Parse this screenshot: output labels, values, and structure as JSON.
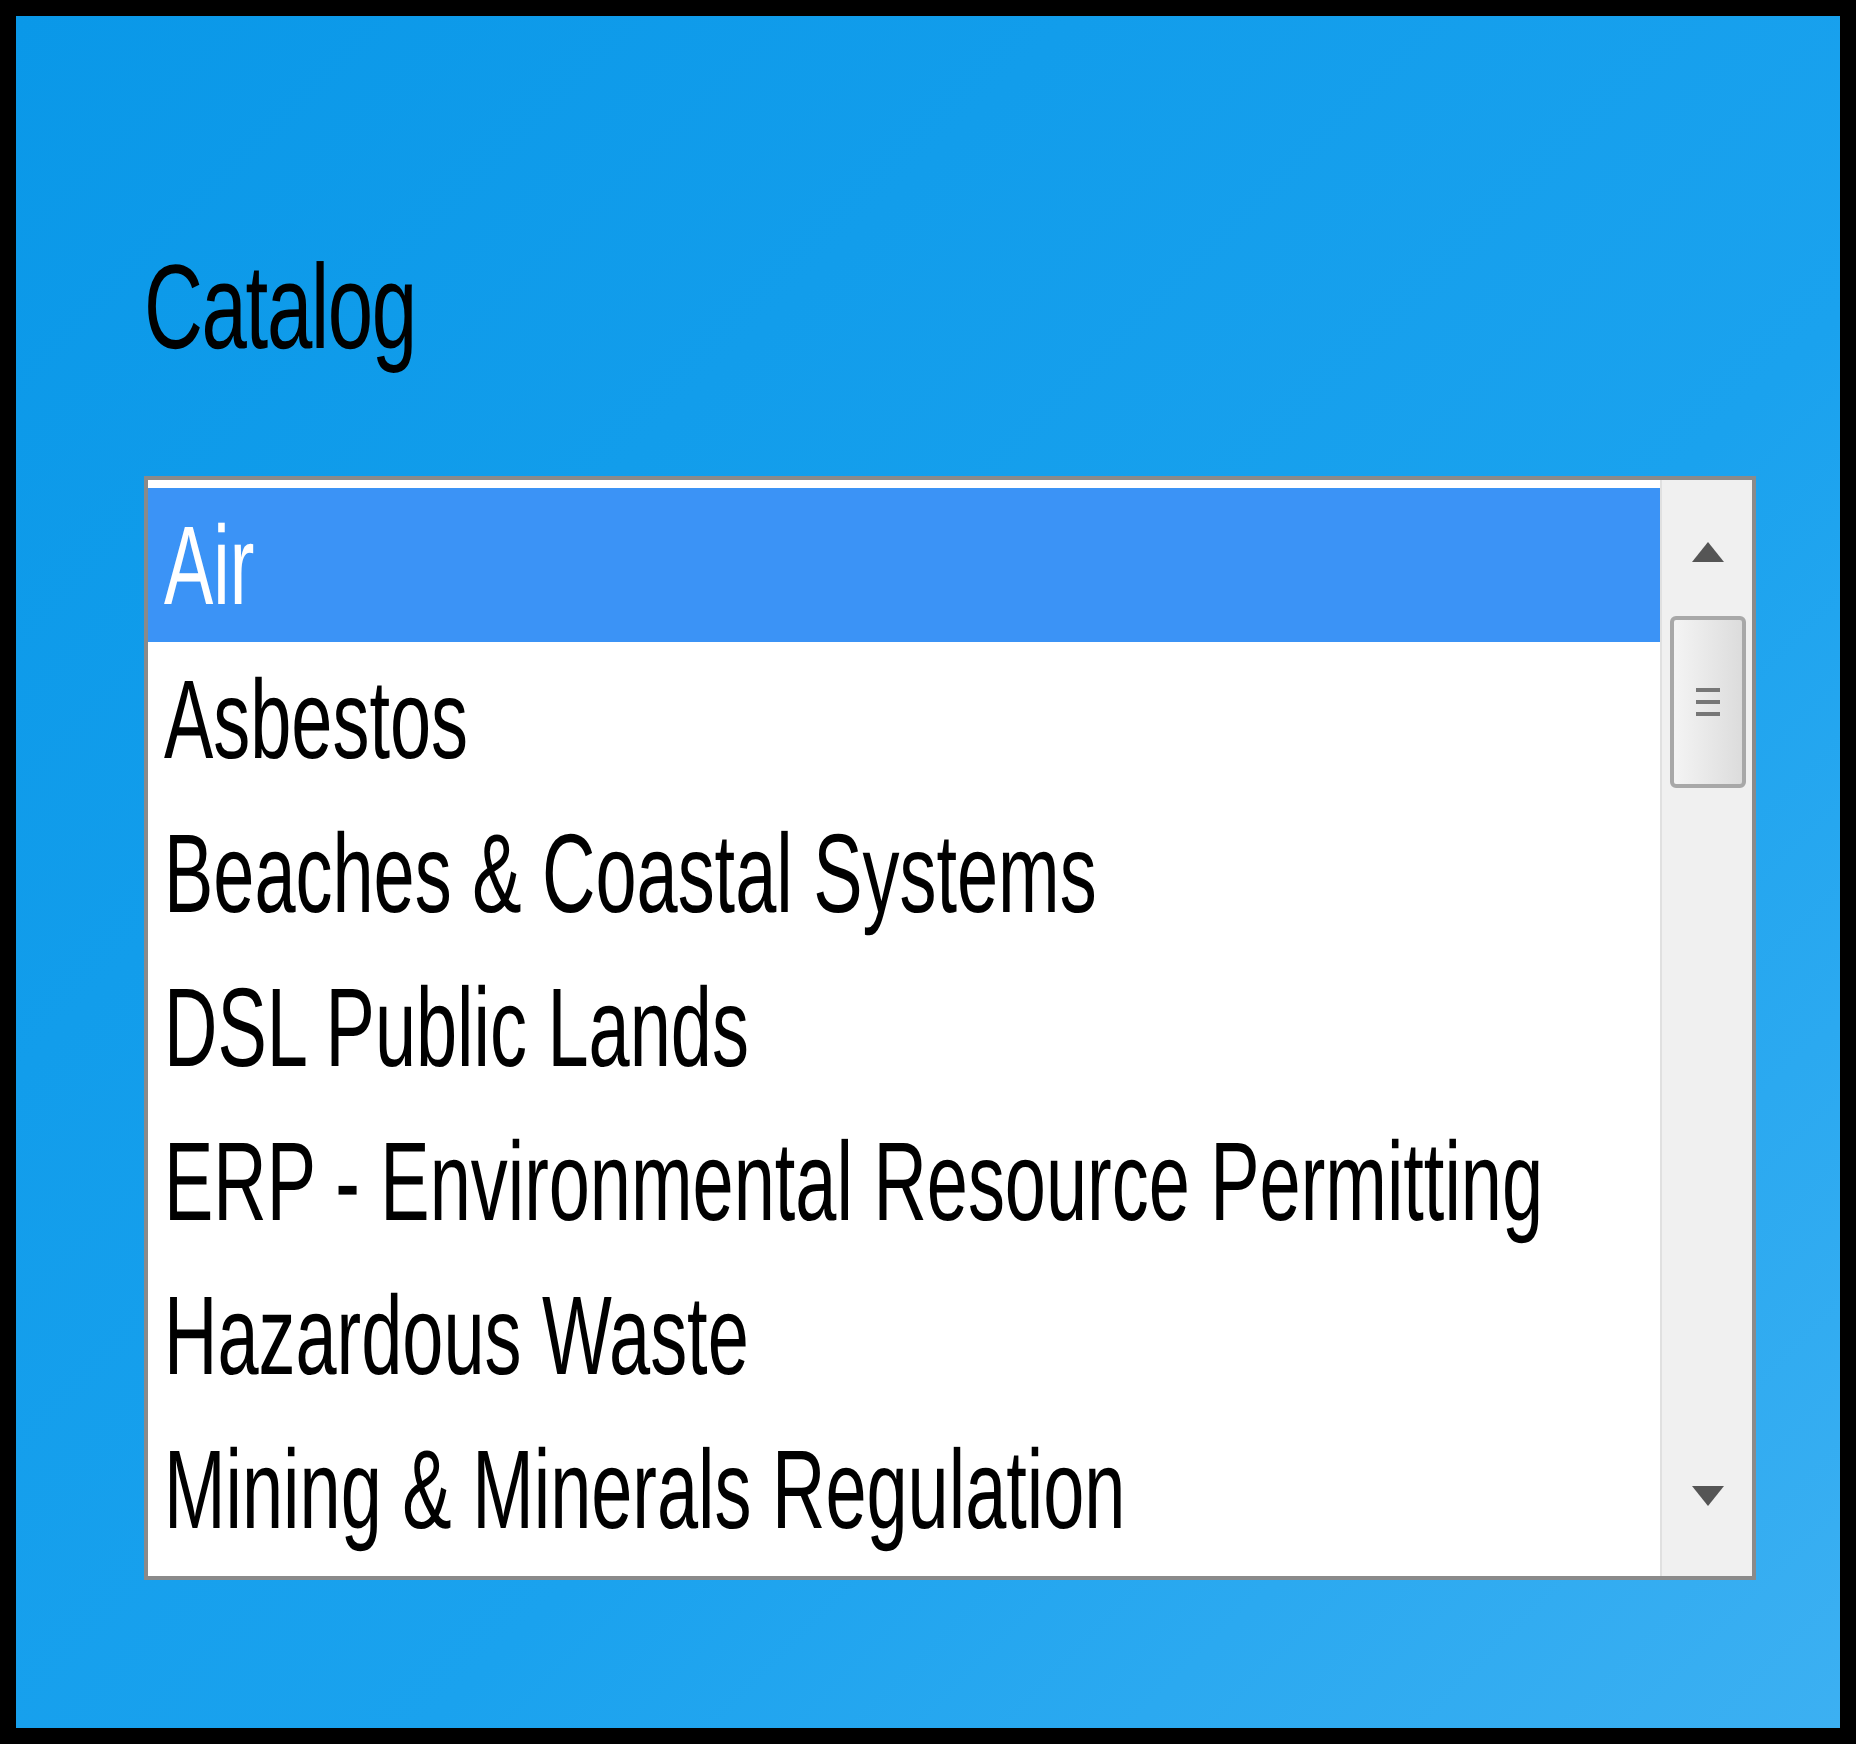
{
  "title": "Catalog",
  "catalog_list": {
    "items": [
      {
        "label": "Air",
        "selected": true
      },
      {
        "label": "Asbestos",
        "selected": false
      },
      {
        "label": "Beaches & Coastal Systems",
        "selected": false
      },
      {
        "label": "DSL Public Lands",
        "selected": false
      },
      {
        "label": "ERP - Environmental Resource Permitting",
        "selected": false
      },
      {
        "label": "Hazardous Waste",
        "selected": false
      },
      {
        "label": "Mining & Minerals Regulation",
        "selected": false
      }
    ]
  }
}
